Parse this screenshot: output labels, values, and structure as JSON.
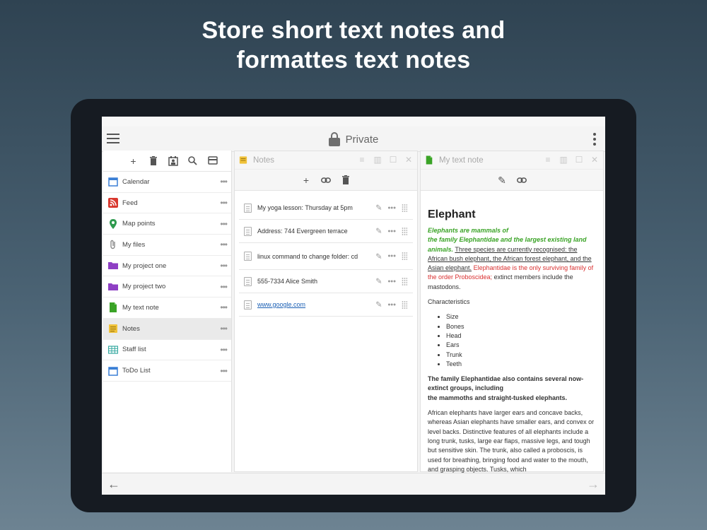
{
  "headline": {
    "line1": "Store short text notes and",
    "line2": "formattes text notes"
  },
  "appbar": {
    "title": "Private"
  },
  "sidebar": {
    "items": [
      {
        "label": "Calendar",
        "icon": "calendar-icon",
        "color": "#3a7fd5"
      },
      {
        "label": "Feed",
        "icon": "rss-icon",
        "color": "#d9382e"
      },
      {
        "label": "Map points",
        "icon": "map-pin-icon",
        "color": "#2e9a4e"
      },
      {
        "label": "My files",
        "icon": "paperclip-icon",
        "color": "#888888"
      },
      {
        "label": "My project one",
        "icon": "folder-icon",
        "color": "#8e3fc4"
      },
      {
        "label": "My project two",
        "icon": "folder-icon",
        "color": "#8e3fc4"
      },
      {
        "label": "My text note",
        "icon": "text-note-icon",
        "color": "#3aa326"
      },
      {
        "label": "Notes",
        "icon": "notes-icon",
        "color": "#f0c23a"
      },
      {
        "label": "Staff list",
        "icon": "table-icon",
        "color": "#35a8a0"
      },
      {
        "label": "ToDo List",
        "icon": "calendar-icon",
        "color": "#3a7fd5"
      }
    ],
    "active_index": 7
  },
  "notes_panel": {
    "title": "Notes",
    "rows": [
      {
        "text": "My yoga lesson: Thursday at 5pm"
      },
      {
        "text": "Address: 744 Evergreen terrace"
      },
      {
        "text": "linux command to change folder: cd"
      },
      {
        "text": "555-7334 Alice Smith"
      },
      {
        "text": "www.google.com",
        "is_link": true
      }
    ]
  },
  "text_panel": {
    "title": "My text note",
    "heading": "Elephant",
    "green_line1": "Elephants are mammals of",
    "green_line2": "the family Elephantidae and the largest existing land animals.",
    "underline_text": "Three species are currently recognised: the African bush elephant, the African forest elephant, and the Asian elephant.",
    "red_text": "Elephantidae is the only surviving family of the order Proboscidea;",
    "after_red": "extinct members include the mastodons.",
    "characteristics_label": "Characteristics",
    "list": [
      "Size",
      "Bones",
      "Head",
      "Ears",
      "Trunk",
      "Teeth"
    ],
    "bold_para_1": "The family Elephantidae also contains several now-extinct groups, including",
    "bold_para_2": "the mammoths and straight-tusked elephants.",
    "para": "African elephants have larger ears and concave backs, whereas Asian elephants have smaller ears, and convex or level backs. Distinctive features of all elephants include a long trunk, tusks, large ear flaps, massive legs, and tough but sensitive skin. The trunk, also called a proboscis, is used for breathing, bringing food and water to the mouth, and grasping objects. Tusks, which"
  },
  "colors": {
    "green_text": "#3aa326",
    "red_text": "#d93030",
    "link": "#1a5fb4"
  }
}
